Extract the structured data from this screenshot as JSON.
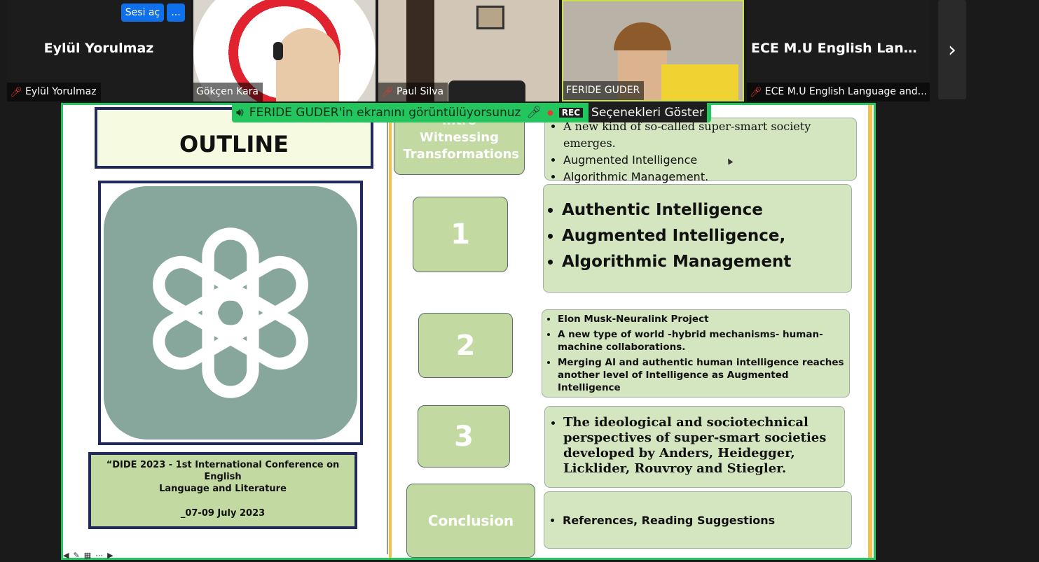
{
  "participants": [
    {
      "big_name": "Eylül Yorulmaz",
      "label": "Eylül Yorulmaz",
      "muted": true
    },
    {
      "big_name": "",
      "label": "Gökçen Kara",
      "muted": false
    },
    {
      "big_name": "",
      "label": "Paul Silva",
      "muted": true
    },
    {
      "big_name": "",
      "label": "FERIDE GUDER",
      "muted": false
    },
    {
      "big_name": "ECE M.U English Langu...",
      "label": "ECE M.U English Language and...",
      "muted": true
    }
  ],
  "controls": {
    "open_audio": "Sesi aç",
    "more": "...",
    "next_arrow": "›"
  },
  "share_banner": {
    "text": "FERIDE GUDER'in ekranını görüntülüyorsunuz",
    "rec": "REC",
    "options": "Seçenekleri Göster"
  },
  "slide": {
    "outline_title": "OUTLINE",
    "conference": {
      "line1": "“DIDE 2023 - 1st International Conference on English",
      "line2": "Language and Literature",
      "line3": "_07-09 July 2023"
    },
    "rows": [
      {
        "left_label_top": "Intro",
        "left_label": "Witnessing Transformations",
        "bullets": [
          "A new kind of so-called super-smart society emerges.",
          "Augmented Intelligence",
          "Algorithmic Management."
        ]
      },
      {
        "left_label": "1",
        "bullets": [
          "Authentic Intelligence",
          "Augmented Intelligence,",
          "Algorithmic Management"
        ]
      },
      {
        "left_label": "2",
        "bullets": [
          "Elon Musk-Neuralink Project",
          "A new type of world -hybrid mechanisms- human-machine collaborations.",
          "Merging AI and authentic human intelligence reaches another level of Intelligence as Augmented Intelligence"
        ]
      },
      {
        "left_label": "3",
        "bullets": [
          "The ideological and sociotechnical perspectives of super-smart societies developed by Anders, Heidegger, Licklider, Rouvroy and Stiegler."
        ]
      },
      {
        "left_label": "Conclusion",
        "bullets": [
          "References, Reading Suggestions"
        ]
      }
    ]
  }
}
